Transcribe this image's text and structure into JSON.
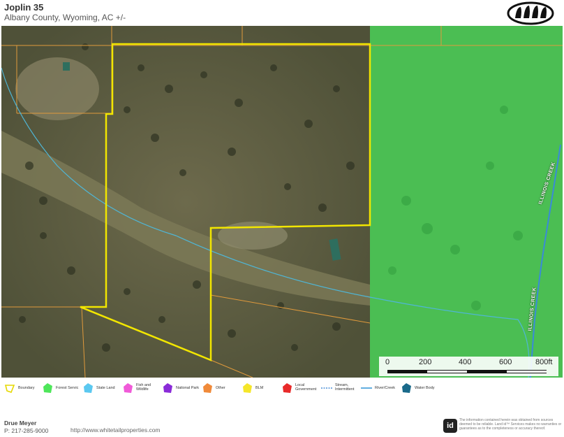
{
  "header": {
    "title": "Joplin 35",
    "subtitle": "Albany County, Wyoming,  AC +/-"
  },
  "map": {
    "creek_label": "ILLINOIS CREEK",
    "colors": {
      "boundary": "#f2e600",
      "forest_service": "#35d84f",
      "parcel_lines": "#e09a3c",
      "stream": "#4fb6d6",
      "river": "#3a9ad9"
    }
  },
  "scale": {
    "ticks": [
      "0",
      "200",
      "400",
      "600",
      "800ft"
    ]
  },
  "legend": {
    "items": [
      {
        "label": "Boundary",
        "icon": "boundary-outline",
        "color": "#f2e600"
      },
      {
        "label": "Forest Servic",
        "icon": "polygon",
        "color": "#4ee65a"
      },
      {
        "label": "State Land",
        "icon": "polygon",
        "color": "#5bc8f0"
      },
      {
        "label": "Fish and\nWildlife",
        "icon": "polygon",
        "color": "#f05ad8"
      },
      {
        "label": "National Park",
        "icon": "polygon",
        "color": "#8a2bd8"
      },
      {
        "label": "Other",
        "icon": "polygon",
        "color": "#f08a3a"
      },
      {
        "label": "BLM",
        "icon": "polygon",
        "color": "#f5e62a"
      },
      {
        "label": "Local\nGovernment",
        "icon": "polygon",
        "color": "#e82a2a"
      },
      {
        "label": "Stream,\nIntermittent",
        "icon": "dotted-line",
        "color": "#4a8fd6"
      },
      {
        "label": "River/Creek",
        "icon": "line",
        "color": "#3a9ad9"
      },
      {
        "label": "Water Body",
        "icon": "polygon",
        "color": "#1a6a8a"
      }
    ]
  },
  "footer": {
    "agent_name": "Drue Meyer",
    "phone": "P: 217-285-9000",
    "url": "http://www.whitetailproperties.com",
    "disclaimer_logo": "id",
    "disclaimer": "The information contained herein was obtained from sources deemed to be reliable. Land id™ Services makes no warranties or guarantees as to the completeness or accuracy thereof."
  }
}
